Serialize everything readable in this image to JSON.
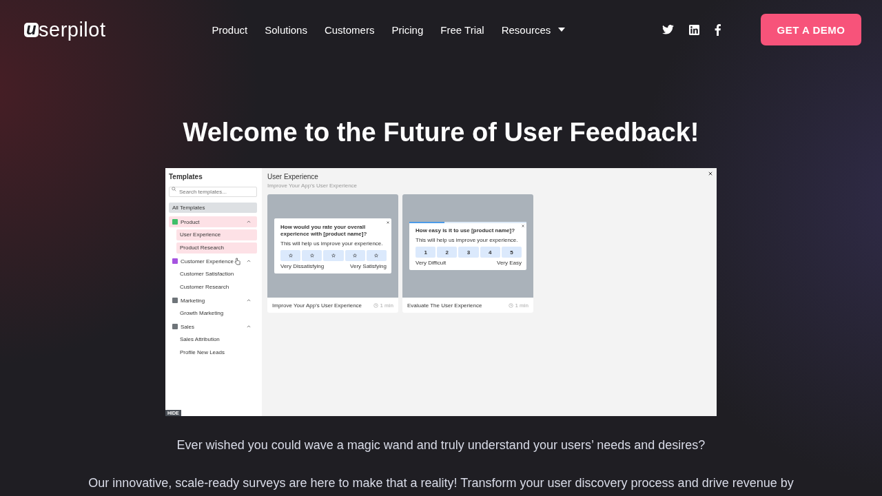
{
  "header": {
    "logo_mark": "u",
    "logo_text": "serpilot",
    "nav": [
      {
        "label": "Product",
        "dropdown": false
      },
      {
        "label": "Solutions",
        "dropdown": false
      },
      {
        "label": "Customers",
        "dropdown": false
      },
      {
        "label": "Pricing",
        "dropdown": false
      },
      {
        "label": "Free Trial",
        "dropdown": false
      },
      {
        "label": "Resources",
        "dropdown": true
      }
    ],
    "social": [
      {
        "kind": "twitter"
      },
      {
        "kind": "linkedin"
      },
      {
        "kind": "facebook"
      }
    ],
    "cta": "GET A DEMO"
  },
  "heading": "Welcome to the Future of User Feedback!",
  "demo": {
    "sidebar": {
      "title": "Templates",
      "search_placeholder": "Search templates...",
      "all_templates": "All Templates",
      "categories": [
        {
          "label": "Product",
          "color": "#3fbf6a",
          "expanded": true,
          "selected": true,
          "children": [
            {
              "label": "User Experience",
              "selected": true
            },
            {
              "label": "Product Research",
              "selected": true
            }
          ]
        },
        {
          "label": "Customer Experience",
          "color": "#a653e0",
          "expanded": true,
          "selected": false,
          "children": [
            {
              "label": "Customer Satisfaction",
              "selected": false
            },
            {
              "label": "Customer Research",
              "selected": false
            }
          ]
        },
        {
          "label": "Marketing",
          "color": "#6e7479",
          "expanded": true,
          "selected": false,
          "children": [
            {
              "label": "Growth Marketing",
              "selected": false
            }
          ]
        },
        {
          "label": "Sales",
          "color": "#6e7479",
          "expanded": true,
          "selected": false,
          "children": [
            {
              "label": "Sales Attribution",
              "selected": false
            },
            {
              "label": "Profile New Leads",
              "selected": false
            }
          ]
        }
      ]
    },
    "main": {
      "title": "User Experience",
      "subtitle": "Improve Your App's User Experience",
      "cards": [
        {
          "kind": "stars",
          "question": "How would you rate your overall experience with [product name]?",
          "hint": "This will help us improve your experience.",
          "low": "Very Dissatisfying",
          "high": "Very Satisfying",
          "name": "Improve Your App's User Experience",
          "time": "1 min"
        },
        {
          "kind": "numbers",
          "level": 0.3,
          "question": "How easy is it to use [product name]?",
          "hint": "This will help us improve your experience.",
          "options": [
            "1",
            "2",
            "3",
            "4",
            "5"
          ],
          "low": "Very Difficult",
          "high": "Very Easy",
          "name": "Evaluate The User Experience",
          "time": "1 min"
        }
      ]
    },
    "hide_label": "HIDE"
  },
  "paragraphs": [
    "Ever wished you could wave a magic wand and truly understand your users’ needs and desires?",
    "Our innovative, scale-ready surveys are here to make that a reality! Transform your user discovery process and drive revenue by"
  ]
}
